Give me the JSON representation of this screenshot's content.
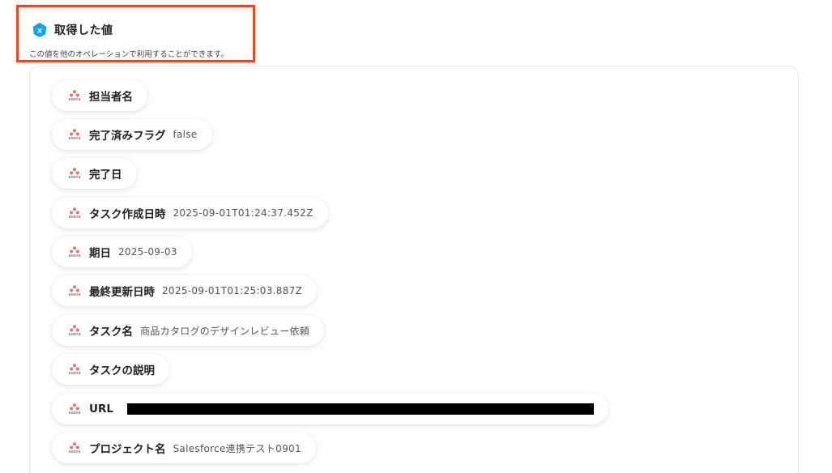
{
  "header": {
    "title": "取得した値",
    "description": "この値を他のオペレーションで利用することができます。"
  },
  "colors": {
    "highlight_border": "#e8472a",
    "icon_blue": "#1aa3e8",
    "asana_coral": "#f06a6a"
  },
  "asana_logo_text": "asana",
  "fields": [
    {
      "label": "担当者名",
      "value": ""
    },
    {
      "label": "完了済みフラグ",
      "value": "false"
    },
    {
      "label": "完了日",
      "value": ""
    },
    {
      "label": "タスク作成日時",
      "value": "2025-09-01T01:24:37.452Z"
    },
    {
      "label": "期日",
      "value": "2025-09-03"
    },
    {
      "label": "最終更新日時",
      "value": "2025-09-01T01:25:03.887Z"
    },
    {
      "label": "タスク名",
      "value": "商品カタログのデザインレビュー依頼"
    },
    {
      "label": "タスクの説明",
      "value": ""
    },
    {
      "label": "URL",
      "value": ""
    },
    {
      "label": "プロジェクト名",
      "value": "Salesforce連携テスト0901"
    }
  ]
}
